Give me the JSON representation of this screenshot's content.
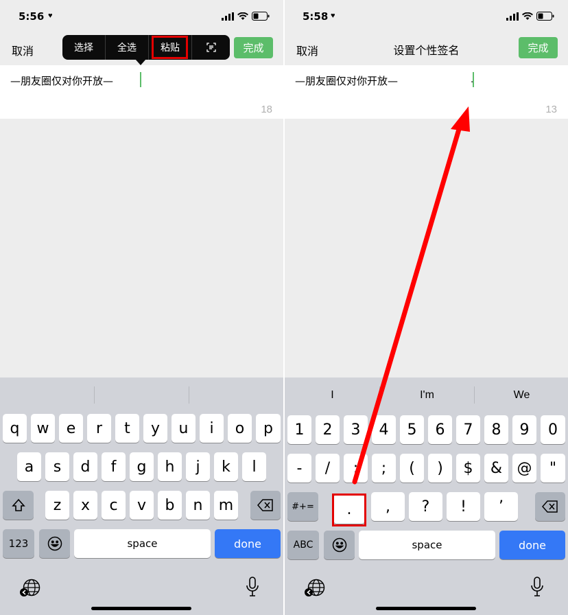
{
  "left": {
    "status": {
      "time": "5:56"
    },
    "nav": {
      "cancel": "取消",
      "done": "完成"
    },
    "edit_menu": {
      "select": "选择",
      "select_all": "全选",
      "paste": "粘贴",
      "scan_text_icon": "scan-text-icon"
    },
    "signature": {
      "text": "—朋友圈仅对你开放—",
      "count": "18"
    },
    "keyboard": {
      "row1": [
        "q",
        "w",
        "e",
        "r",
        "t",
        "y",
        "u",
        "i",
        "o",
        "p"
      ],
      "row2": [
        "a",
        "s",
        "d",
        "f",
        "g",
        "h",
        "j",
        "k",
        "l"
      ],
      "row3": [
        "z",
        "x",
        "c",
        "v",
        "b",
        "n",
        "m"
      ],
      "numbers_key": "123",
      "space": "space",
      "done": "done"
    }
  },
  "right": {
    "status": {
      "time": "5:58"
    },
    "nav": {
      "cancel": "取消",
      "title": "设置个性签名",
      "done": "完成"
    },
    "signature": {
      "text": "—朋友圈仅对你开放—",
      "dot": ".",
      "count": "13"
    },
    "keyboard": {
      "suggestions": [
        "I",
        "I'm",
        "We"
      ],
      "row1": [
        "1",
        "2",
        "3",
        "4",
        "5",
        "6",
        "7",
        "8",
        "9",
        "0"
      ],
      "row2": [
        "-",
        "/",
        ":",
        ";",
        "(",
        ")",
        "$",
        "&",
        "@",
        "\""
      ],
      "row3": [
        ".",
        ",",
        "?",
        "!",
        "’"
      ],
      "symbols_key": "#+=",
      "abc_key": "ABC",
      "space": "space",
      "done": "done"
    }
  },
  "colors": {
    "accent_green": "#5cbd6a",
    "highlight_red": "#e30000",
    "keyboard_blue": "#3478f6"
  }
}
